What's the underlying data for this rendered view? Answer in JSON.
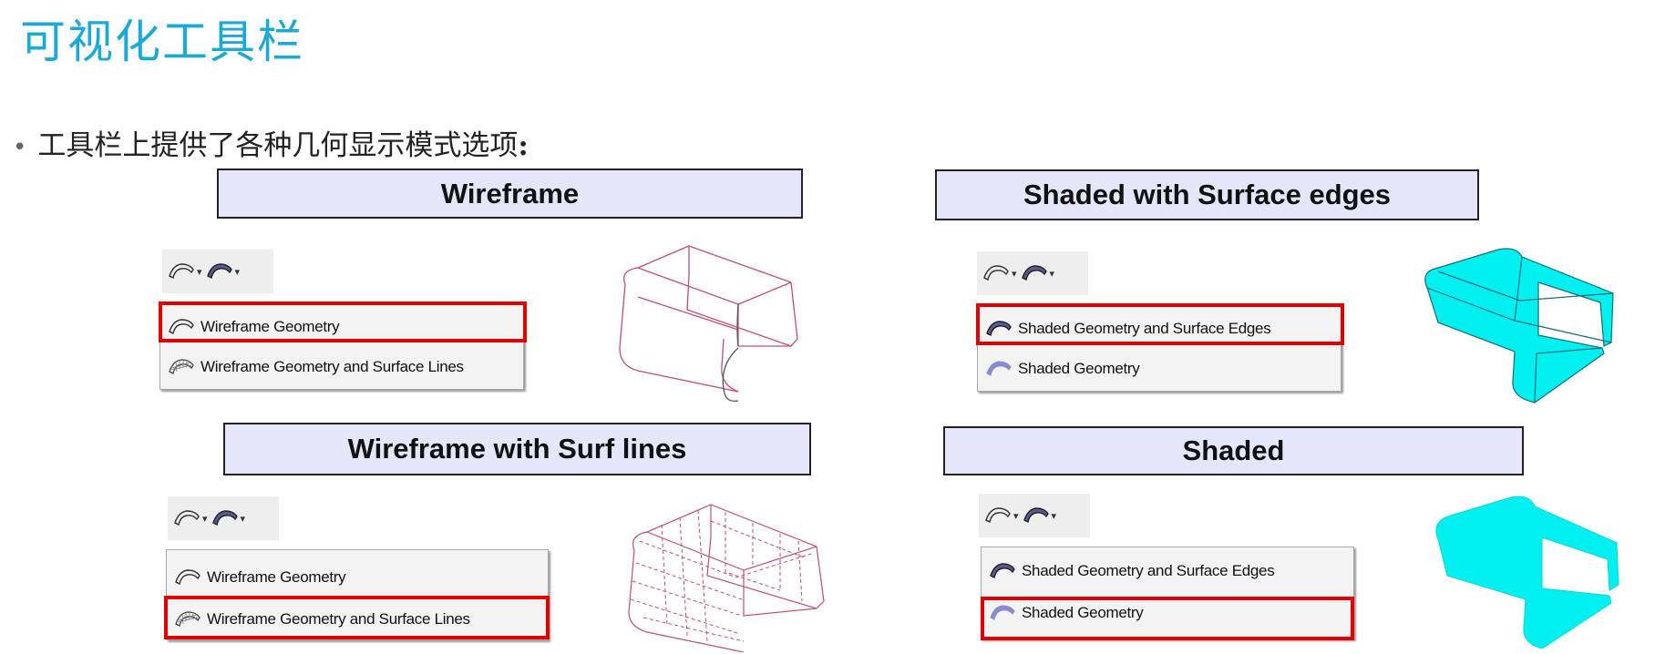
{
  "page": {
    "title": "可视化工具栏",
    "bullet_text": "工具栏上提供了各种几何显示模式选项",
    "bullet_colon": ":"
  },
  "panels": {
    "wireframe": {
      "header": "Wireframe",
      "menu_items": [
        "Wireframe Geometry",
        "Wireframe Geometry and Surface Lines"
      ],
      "highlighted": "Wireframe Geometry"
    },
    "shaded_edges": {
      "header": "Shaded with Surface edges",
      "menu_items": [
        "Shaded Geometry and Surface Edges",
        "Shaded Geometry"
      ],
      "highlighted": "Shaded Geometry and Surface Edges"
    },
    "wireframe_surf": {
      "header": "Wireframe with Surf lines",
      "menu_items": [
        "Wireframe Geometry",
        "Wireframe Geometry and Surface Lines"
      ],
      "highlighted": "Wireframe Geometry and Surface Lines"
    },
    "shaded": {
      "header": "Shaded",
      "menu_items": [
        "Shaded Geometry and Surface Edges",
        "Shaded Geometry"
      ],
      "highlighted": "Shaded Geometry"
    }
  },
  "icons": {
    "wireframe": "wireframe-geometry-icon",
    "wireframe_lines": "wireframe-surface-lines-icon",
    "shaded_edges": "shaded-edges-icon",
    "shaded": "shaded-geometry-icon",
    "dropdown": "chevron-down-icon"
  },
  "colors": {
    "title": "#1ba9d6",
    "header_bg": "#e6e6fb",
    "highlight": "#e00000",
    "wire": "#c0506e",
    "shaded_fill": "#00f0f0",
    "shaded_icon": "#6a6aa8"
  }
}
